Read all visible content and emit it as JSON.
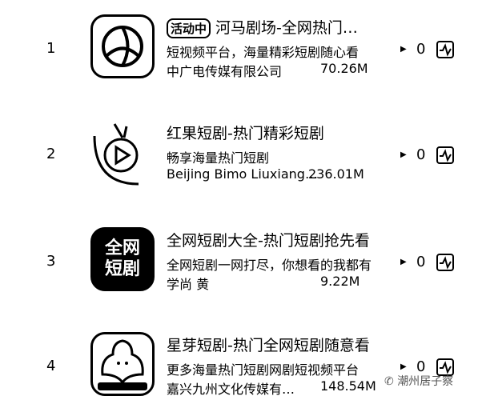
{
  "apps": [
    {
      "rank": "1",
      "badge": "活动中",
      "title": "河马剧场-全网热门…",
      "subtitle": "短视频平台，海量精彩短剧随心看",
      "developer": "中广电传媒有限公司",
      "size": "70.26M",
      "count": "0"
    },
    {
      "rank": "2",
      "title": "红果短剧-热门精彩短剧",
      "subtitle": "畅享海量热门短剧",
      "developer": "Beijing Bimo Liuxiang…",
      "size": "236.01M",
      "count": "0"
    },
    {
      "rank": "3",
      "title": "全网短剧大全-热门短剧抢先看",
      "subtitle": "全网短剧一网打尽，你想看的我都有",
      "developer": "学尚 黄",
      "size": "9.22M",
      "count": "0",
      "icon_text": "全网短剧"
    },
    {
      "rank": "4",
      "title": "星芽短剧-热门全网短剧随意看",
      "subtitle": "更多海量热门短剧网剧短视频平台",
      "developer": "嘉兴九州文化传媒有…",
      "size": "148.54M",
      "count": "0"
    }
  ],
  "watermark": "潮州居子察"
}
